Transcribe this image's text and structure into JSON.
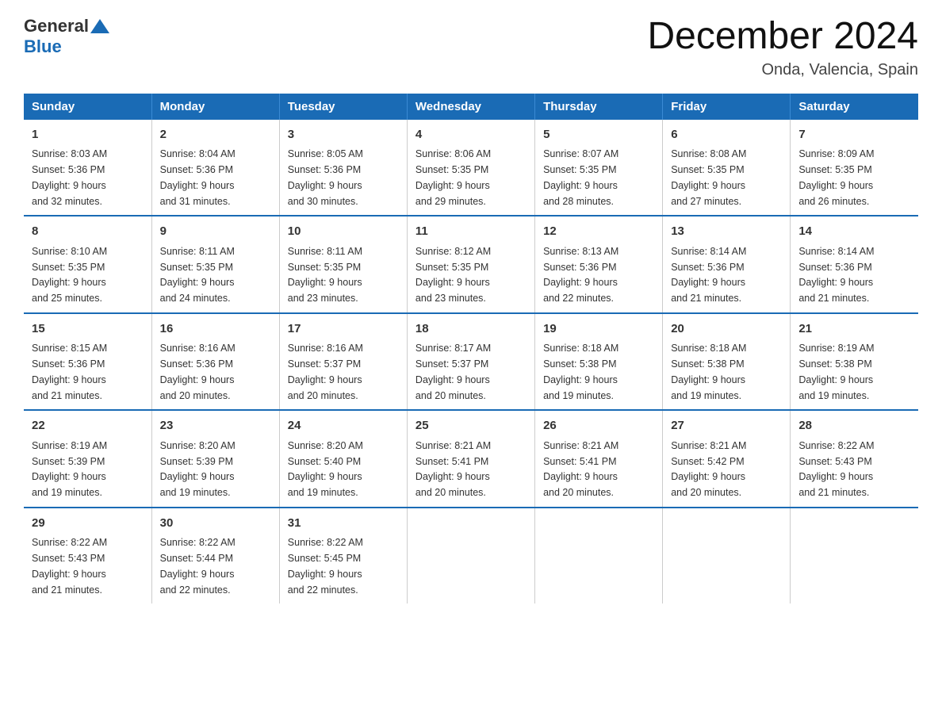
{
  "header": {
    "logo_general": "General",
    "logo_blue": "Blue",
    "title": "December 2024",
    "subtitle": "Onda, Valencia, Spain"
  },
  "weekdays": [
    "Sunday",
    "Monday",
    "Tuesday",
    "Wednesday",
    "Thursday",
    "Friday",
    "Saturday"
  ],
  "weeks": [
    [
      {
        "day": "1",
        "sunrise": "8:03 AM",
        "sunset": "5:36 PM",
        "daylight": "9 hours and 32 minutes."
      },
      {
        "day": "2",
        "sunrise": "8:04 AM",
        "sunset": "5:36 PM",
        "daylight": "9 hours and 31 minutes."
      },
      {
        "day": "3",
        "sunrise": "8:05 AM",
        "sunset": "5:36 PM",
        "daylight": "9 hours and 30 minutes."
      },
      {
        "day": "4",
        "sunrise": "8:06 AM",
        "sunset": "5:35 PM",
        "daylight": "9 hours and 29 minutes."
      },
      {
        "day": "5",
        "sunrise": "8:07 AM",
        "sunset": "5:35 PM",
        "daylight": "9 hours and 28 minutes."
      },
      {
        "day": "6",
        "sunrise": "8:08 AM",
        "sunset": "5:35 PM",
        "daylight": "9 hours and 27 minutes."
      },
      {
        "day": "7",
        "sunrise": "8:09 AM",
        "sunset": "5:35 PM",
        "daylight": "9 hours and 26 minutes."
      }
    ],
    [
      {
        "day": "8",
        "sunrise": "8:10 AM",
        "sunset": "5:35 PM",
        "daylight": "9 hours and 25 minutes."
      },
      {
        "day": "9",
        "sunrise": "8:11 AM",
        "sunset": "5:35 PM",
        "daylight": "9 hours and 24 minutes."
      },
      {
        "day": "10",
        "sunrise": "8:11 AM",
        "sunset": "5:35 PM",
        "daylight": "9 hours and 23 minutes."
      },
      {
        "day": "11",
        "sunrise": "8:12 AM",
        "sunset": "5:35 PM",
        "daylight": "9 hours and 23 minutes."
      },
      {
        "day": "12",
        "sunrise": "8:13 AM",
        "sunset": "5:36 PM",
        "daylight": "9 hours and 22 minutes."
      },
      {
        "day": "13",
        "sunrise": "8:14 AM",
        "sunset": "5:36 PM",
        "daylight": "9 hours and 21 minutes."
      },
      {
        "day": "14",
        "sunrise": "8:14 AM",
        "sunset": "5:36 PM",
        "daylight": "9 hours and 21 minutes."
      }
    ],
    [
      {
        "day": "15",
        "sunrise": "8:15 AM",
        "sunset": "5:36 PM",
        "daylight": "9 hours and 21 minutes."
      },
      {
        "day": "16",
        "sunrise": "8:16 AM",
        "sunset": "5:36 PM",
        "daylight": "9 hours and 20 minutes."
      },
      {
        "day": "17",
        "sunrise": "8:16 AM",
        "sunset": "5:37 PM",
        "daylight": "9 hours and 20 minutes."
      },
      {
        "day": "18",
        "sunrise": "8:17 AM",
        "sunset": "5:37 PM",
        "daylight": "9 hours and 20 minutes."
      },
      {
        "day": "19",
        "sunrise": "8:18 AM",
        "sunset": "5:38 PM",
        "daylight": "9 hours and 19 minutes."
      },
      {
        "day": "20",
        "sunrise": "8:18 AM",
        "sunset": "5:38 PM",
        "daylight": "9 hours and 19 minutes."
      },
      {
        "day": "21",
        "sunrise": "8:19 AM",
        "sunset": "5:38 PM",
        "daylight": "9 hours and 19 minutes."
      }
    ],
    [
      {
        "day": "22",
        "sunrise": "8:19 AM",
        "sunset": "5:39 PM",
        "daylight": "9 hours and 19 minutes."
      },
      {
        "day": "23",
        "sunrise": "8:20 AM",
        "sunset": "5:39 PM",
        "daylight": "9 hours and 19 minutes."
      },
      {
        "day": "24",
        "sunrise": "8:20 AM",
        "sunset": "5:40 PM",
        "daylight": "9 hours and 19 minutes."
      },
      {
        "day": "25",
        "sunrise": "8:21 AM",
        "sunset": "5:41 PM",
        "daylight": "9 hours and 20 minutes."
      },
      {
        "day": "26",
        "sunrise": "8:21 AM",
        "sunset": "5:41 PM",
        "daylight": "9 hours and 20 minutes."
      },
      {
        "day": "27",
        "sunrise": "8:21 AM",
        "sunset": "5:42 PM",
        "daylight": "9 hours and 20 minutes."
      },
      {
        "day": "28",
        "sunrise": "8:22 AM",
        "sunset": "5:43 PM",
        "daylight": "9 hours and 21 minutes."
      }
    ],
    [
      {
        "day": "29",
        "sunrise": "8:22 AM",
        "sunset": "5:43 PM",
        "daylight": "9 hours and 21 minutes."
      },
      {
        "day": "30",
        "sunrise": "8:22 AM",
        "sunset": "5:44 PM",
        "daylight": "9 hours and 22 minutes."
      },
      {
        "day": "31",
        "sunrise": "8:22 AM",
        "sunset": "5:45 PM",
        "daylight": "9 hours and 22 minutes."
      },
      null,
      null,
      null,
      null
    ]
  ]
}
